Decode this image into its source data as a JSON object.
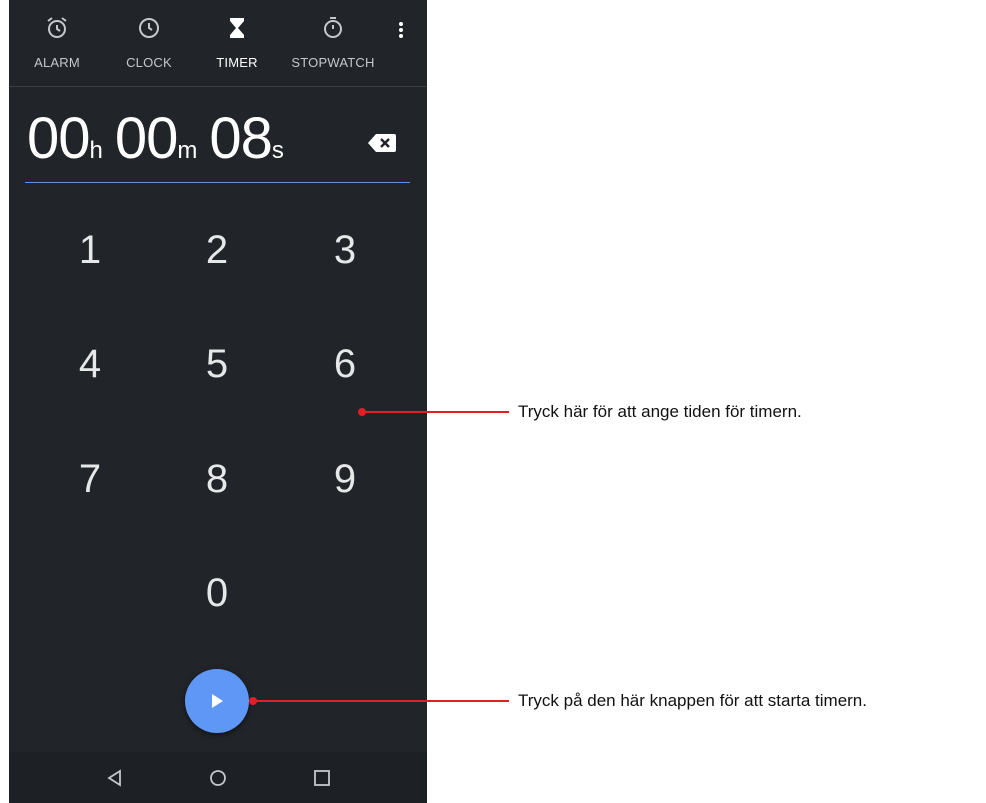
{
  "tabs": [
    {
      "label": "ALARM",
      "icon": "alarm-icon"
    },
    {
      "label": "CLOCK",
      "icon": "clock-icon"
    },
    {
      "label": "TIMER",
      "icon": "hourglass-icon",
      "active": true
    },
    {
      "label": "STOPWATCH",
      "icon": "stopwatch-icon"
    }
  ],
  "timer": {
    "hours": "00",
    "hours_unit": "h",
    "minutes": "00",
    "minutes_unit": "m",
    "seconds": "08",
    "seconds_unit": "s"
  },
  "keypad": [
    "1",
    "2",
    "3",
    "4",
    "5",
    "6",
    "7",
    "8",
    "9",
    "0"
  ],
  "annotations": {
    "keypad_note": "Tryck här för att ange tiden för timern.",
    "start_note": "Tryck på den här knappen för att starta timern."
  },
  "colors": {
    "background": "#212529",
    "accent": "#5e97f6",
    "callout": "#e31e24"
  }
}
